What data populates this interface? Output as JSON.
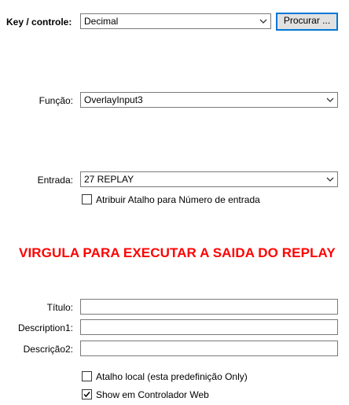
{
  "key_controle": {
    "label": "Key / controle:",
    "selected": "Decimal",
    "search_button": "Procurar ..."
  },
  "funcao": {
    "label": "Função:",
    "selected": "OverlayInput3"
  },
  "entrada": {
    "label": "Entrada:",
    "selected": "27 REPLAY",
    "shortcut_checkbox": {
      "label": "Atribuir Atalho para Número de entrada",
      "checked": false
    }
  },
  "notice": {
    "text": "VIRGULA PARA EXECUTAR A SAIDA DO REPLAY",
    "color": "#ff0000"
  },
  "fields": {
    "titulo_label": "Título:",
    "titulo_value": "",
    "description1_label": "Description1:",
    "description1_value": "",
    "descricao2_label": "Descrição2:",
    "descricao2_value": ""
  },
  "options": {
    "local_shortcut": {
      "label": "Atalho local (esta predefinição Only)",
      "checked": false
    },
    "web_controller": {
      "label": "Show em Controlador Web",
      "checked": true
    }
  },
  "colors": {
    "accent": "#0078d7",
    "border": "#7a7a7a",
    "button_bg": "#e1e1e1"
  },
  "icons": {
    "dropdown": "chevron-down-icon",
    "check": "checkmark-icon"
  }
}
